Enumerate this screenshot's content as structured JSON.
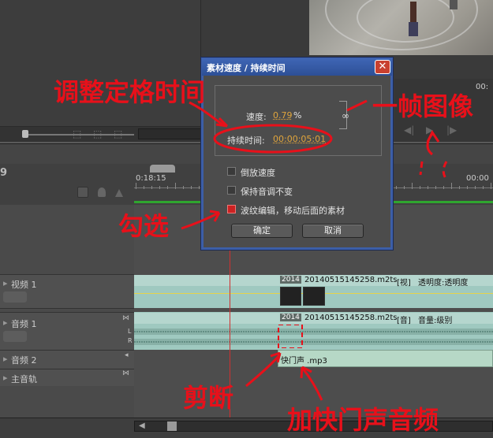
{
  "dialog": {
    "title": "素材速度 / 持续时间",
    "close": "✕",
    "speed_label": "速度:",
    "speed_value": "0.79",
    "speed_unit": "%",
    "duration_label": "持续时间:",
    "duration_value": "00:00:05:01",
    "opt_reverse": "倒放速度",
    "opt_pitch": "保持音调不变",
    "opt_ripple": "波纹编辑，移动后面的素材",
    "ok": "确定",
    "cancel": "取消",
    "checked": {
      "reverse": false,
      "pitch": false,
      "ripple": true
    }
  },
  "timeline": {
    "timecode_partial": "9",
    "ruler_left": "0:18:15",
    "ruler_right": "00:00",
    "tracks": {
      "video1": "视频 1",
      "audio1": "音频 1",
      "audio2": "音频 2",
      "master": "主音轨"
    },
    "clip_video": {
      "tag": "2014",
      "name": "20140515145258.m2ts",
      "kind": "[视]",
      "effect": "透明度:透明度"
    },
    "clip_audio": {
      "tag": "2014",
      "name": "20140515145258.m2ts",
      "kind": "[音]",
      "effect": "音量:级别"
    },
    "clip_audio2": {
      "name": "快门声 .mp3"
    },
    "channel_l": "L",
    "channel_r": "R"
  },
  "program": {
    "timecode_partial": "00:"
  },
  "annotations": {
    "adjust_freeze": "调整定格时间",
    "one_frame": "一帧图像",
    "check": "勾选",
    "cut": "剪断",
    "add_shutter": "加快门声音频"
  },
  "colors": {
    "annotation": "#e8101a",
    "dialog_frame": "#3c5ea7",
    "clip_teal": "#9fc9c0",
    "value_orange": "#e0a53c"
  }
}
